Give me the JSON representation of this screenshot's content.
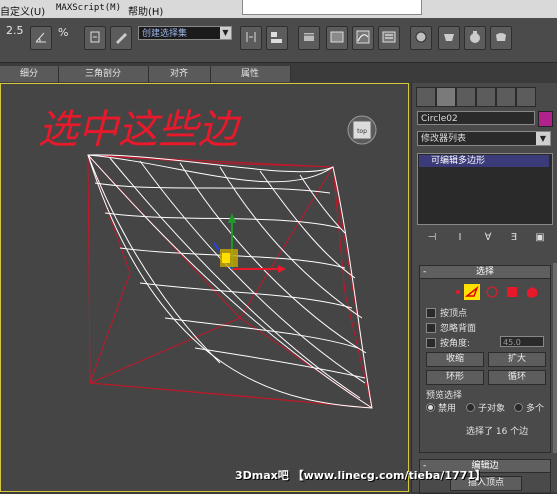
{
  "menu": {
    "items": [
      "自定义(U)",
      "MAXScript(M)",
      "帮助(H)"
    ]
  },
  "toolbar": {
    "snap_value": "2.5",
    "percent_label": "%",
    "selection_set": "创建选择集"
  },
  "ribbon_tabs": [
    "细分",
    "三角剖分",
    "对齐",
    "属性"
  ],
  "viewport": {
    "handwriting": "选中这些边",
    "viewcube_label": "top"
  },
  "command_panel": {
    "object_name": "Circle02",
    "object_color": "#b2228c",
    "modifier_list": "修改器列表",
    "stack_item": "可编辑多边形",
    "selection_rollout": {
      "title": "选择",
      "by_vertex": "按顶点",
      "ignore_backfacing": "忽略背面",
      "by_angle": "按角度:",
      "angle_value": "45.0",
      "shrink": "收缩",
      "grow": "扩大",
      "ring": "环形",
      "loop": "循环",
      "preview_label": "预览选择",
      "preview_off": "禁用",
      "preview_subobject": "子对象",
      "preview_multi": "多个",
      "status": "选择了 16 个边"
    },
    "edit_edges_rollout": {
      "title": "编辑边",
      "insert_vertex": "插入顶点"
    }
  },
  "watermark": "3Dmax吧 【www.linecg.com/tieba/1771】",
  "colors": {
    "viewport_bg": "#454545",
    "wire_white": "#ffffff",
    "wire_red": "#c0182a",
    "accent_yellow": "#ffe000",
    "handwriting_red": "#e8192b"
  }
}
